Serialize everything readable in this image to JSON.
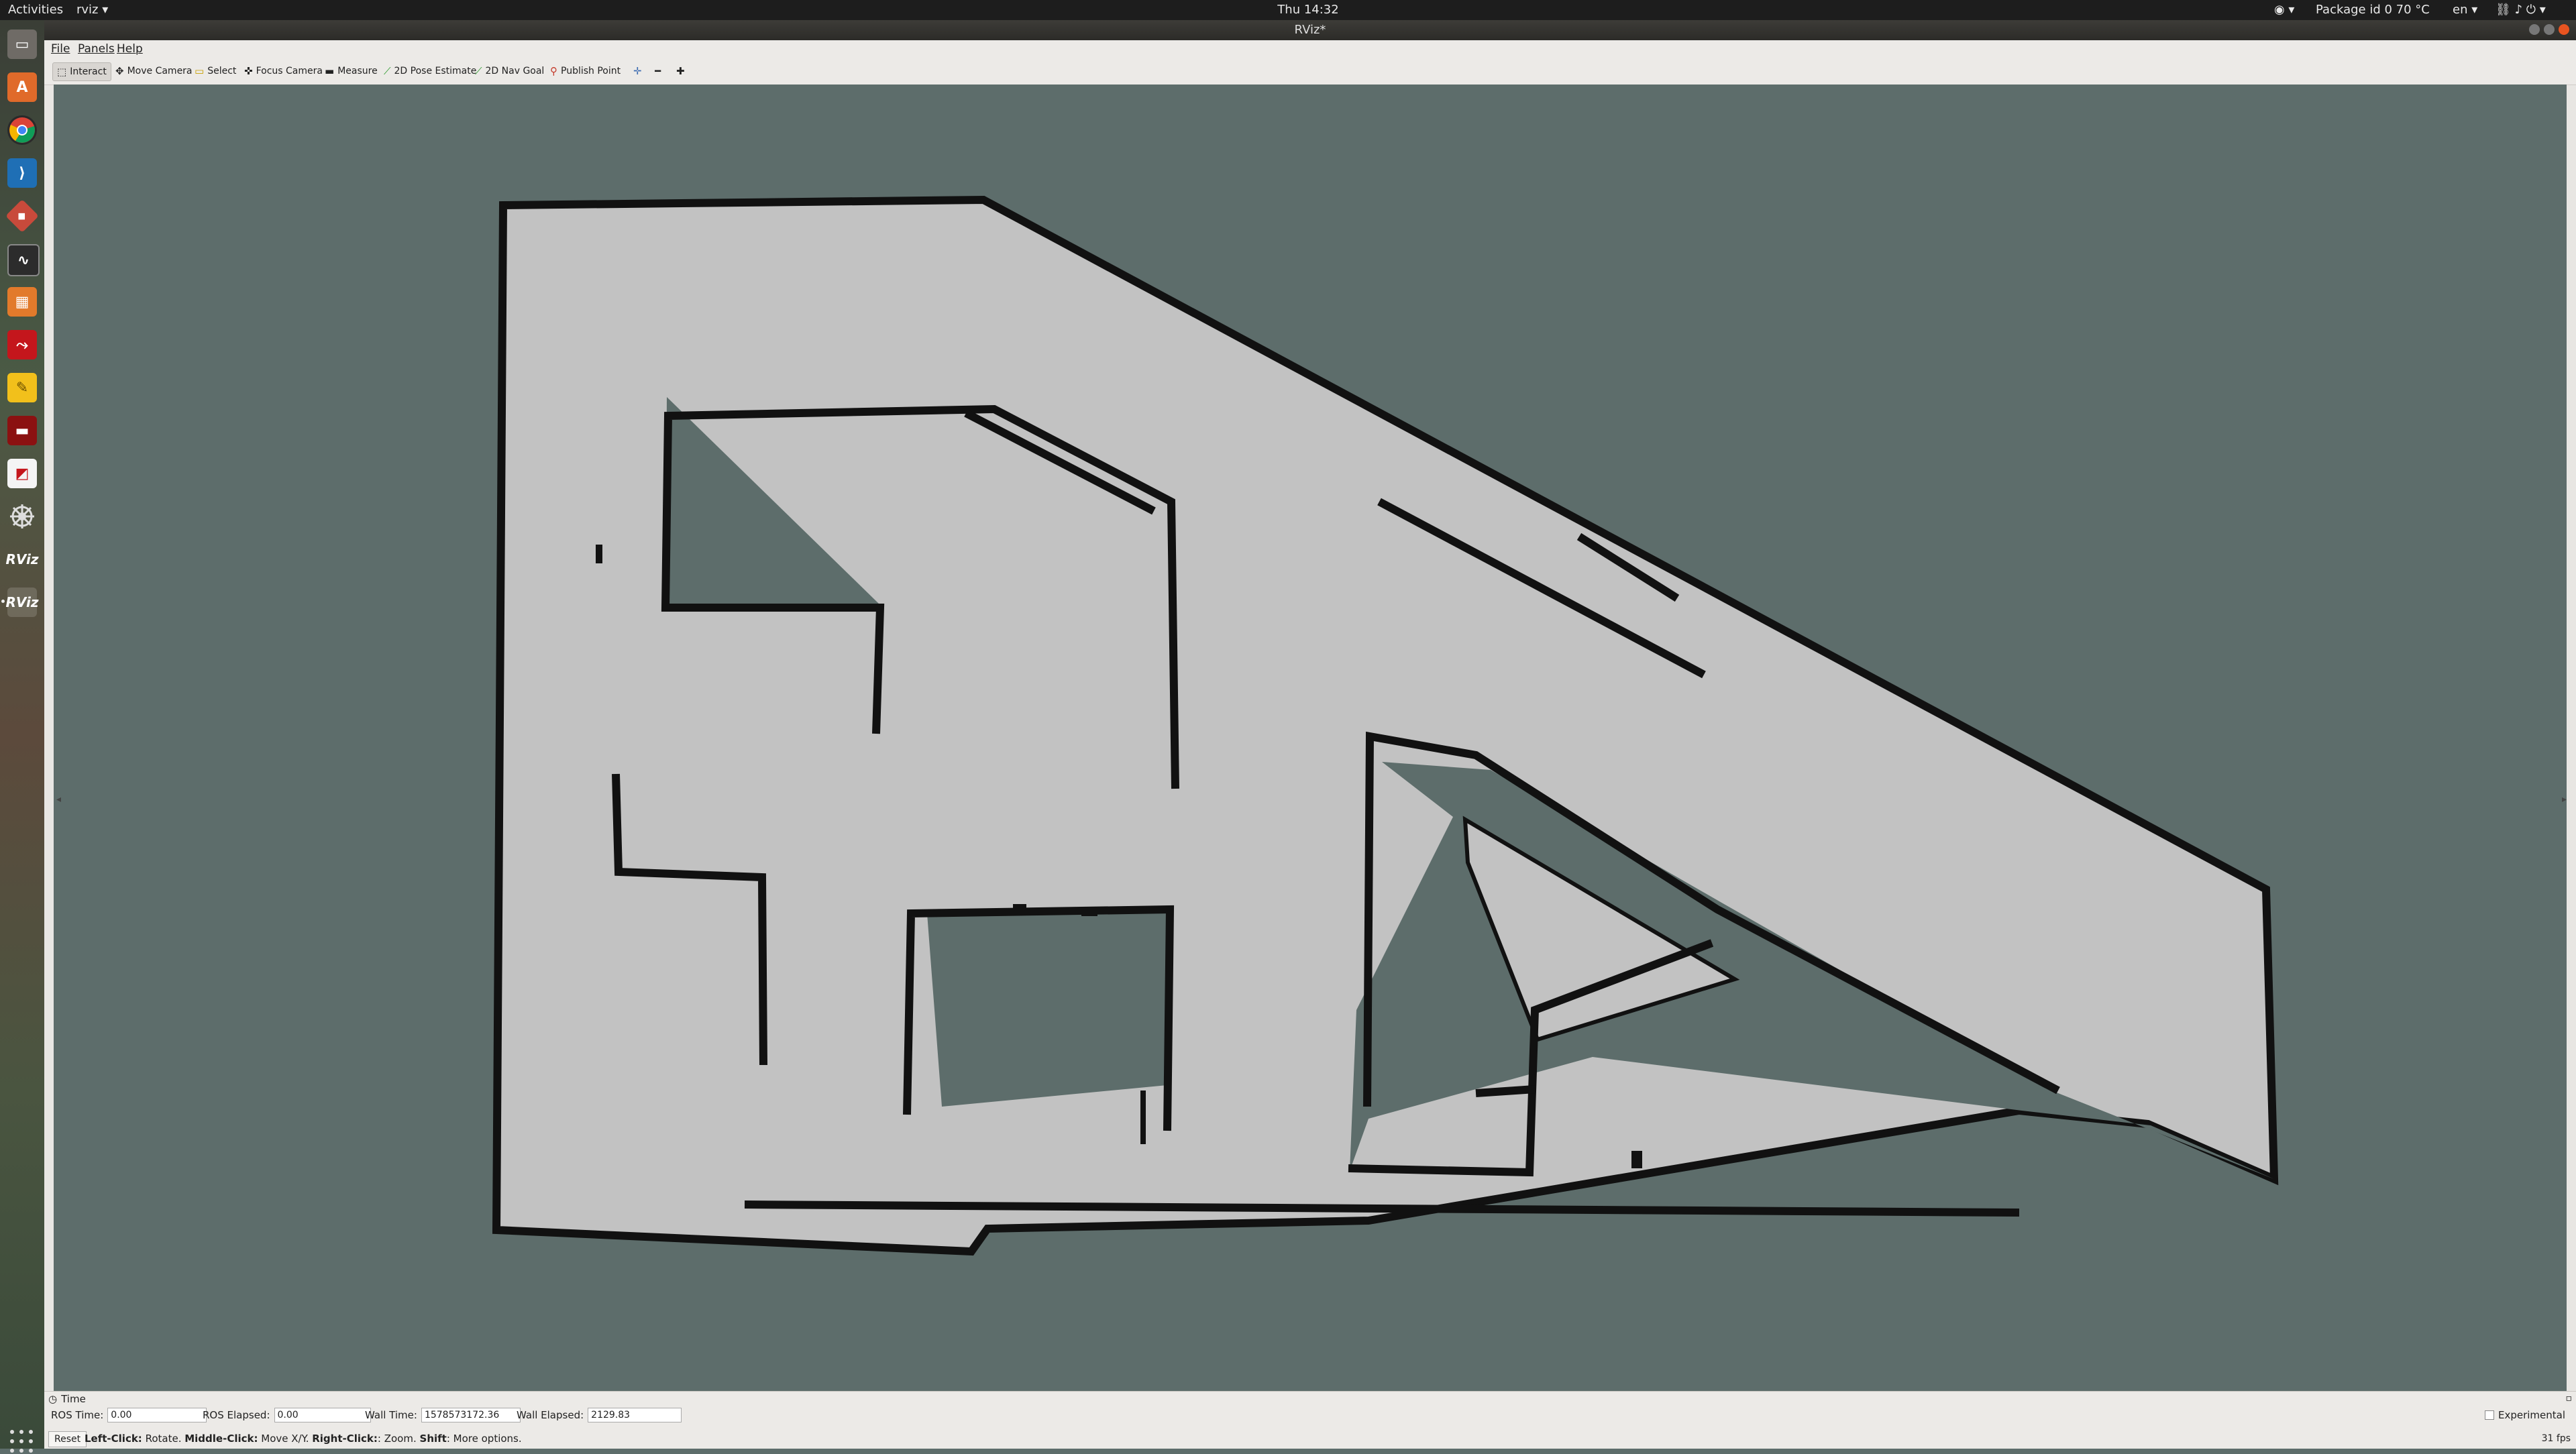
{
  "topbar": {
    "activities": "Activities",
    "app_menu": "rviz ▾",
    "clock": "Thu 14:32",
    "package": "Package id 0 70 °C",
    "lang": "en ▾"
  },
  "dock": {
    "icons": [
      "files-icon",
      "software-store-icon",
      "chrome-icon",
      "vscode-icon",
      "git-icon",
      "system-monitor-icon",
      "calculator-icon",
      "pdf-reader-icon",
      "idea-icon",
      "screen-recorder-icon",
      "document-viewer-icon",
      "ros-icon",
      "rviz-icon",
      "rviz-icon-active"
    ],
    "rviz_label": "RViz"
  },
  "window": {
    "title": "RViz*"
  },
  "menu": {
    "file": "File",
    "panels": "Panels",
    "help": "Help"
  },
  "toolbar": {
    "interact": "Interact",
    "move_camera": "Move Camera",
    "select": "Select",
    "focus_camera": "Focus Camera",
    "measure": "Measure",
    "pose_estimate": "2D Pose Estimate",
    "nav_goal": "2D Nav Goal",
    "publish_point": "Publish Point"
  },
  "time_panel": {
    "title": "Time",
    "ros_time_label": "ROS Time:",
    "ros_time": "0.00",
    "ros_elapsed_label": "ROS Elapsed:",
    "ros_elapsed": "0.00",
    "wall_time_label": "Wall Time:",
    "wall_time": "1578573172.36",
    "wall_elapsed_label": "Wall Elapsed:",
    "wall_elapsed": "2129.83",
    "experimental": "Experimental"
  },
  "status": {
    "reset": "Reset",
    "left_click": "Left-Click:",
    "left_click_desc": " Rotate. ",
    "middle_click": "Middle-Click:",
    "middle_click_desc": " Move X/Y. ",
    "right_click": "Right-Click:",
    "right_click_desc": ": Zoom. ",
    "shift": "Shift",
    "shift_desc": ": More options.",
    "fps": "31 fps"
  },
  "colors": {
    "unknown": "#5d6d6b",
    "free": "#c2c2c2",
    "occupied": "#111111",
    "accent": "#e95420"
  }
}
